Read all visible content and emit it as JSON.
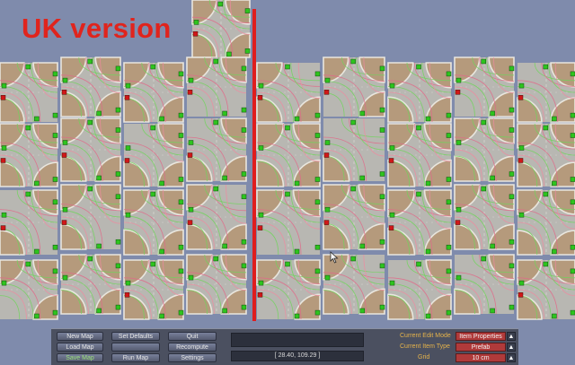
{
  "overlay": {
    "title": "UK version"
  },
  "toolbar": {
    "col1": [
      "New Map",
      "Load Map",
      "Save Map"
    ],
    "col2": [
      "Set Defaults",
      "",
      "Run Map"
    ],
    "col3": [
      "Quit",
      "Recompute",
      "Settings"
    ],
    "coordinates": "[ 28.40, 109.29 ]"
  },
  "properties": {
    "edit_mode_label": "Current Edit Mode",
    "edit_mode_value": "Item Properties",
    "item_type_label": "Current Item Type",
    "item_type_value": "Prefab",
    "grid_label": "Grid",
    "grid_value": "10 cm"
  },
  "colors": {
    "background": "#7f8bac",
    "accent": "#df1d1d",
    "marker_green": "#2ec41e",
    "marker_red": "#d01818"
  }
}
